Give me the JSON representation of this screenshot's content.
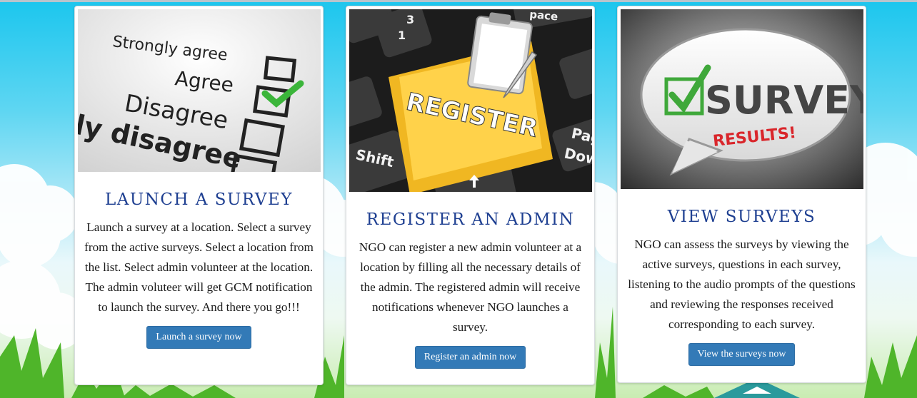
{
  "cards": [
    {
      "title": "LAUNCH A SURVEY",
      "description": "Launch a survey at a location. Select a survey from the active surveys. Select a location from the list. Select admin volunteer at the location. The admin voluteer will get GCM notification to launch the survey. And there you go!!!",
      "button": "Launch a survey now",
      "image": {
        "icon": "checklist-image",
        "lines": [
          "Strongly agree",
          "Agree",
          "Disagree",
          "ly disagree"
        ]
      }
    },
    {
      "title": "REGISTER AN ADMIN",
      "description": "NGO can register a new admin volunteer at a location by filling all the necessary details of the admin. The registered admin will receive notifications whenever NGO launches a survey.",
      "button": "Register an admin now",
      "image": {
        "icon": "keyboard-register-image",
        "key": "REGISTER",
        "shift": "Shift",
        "page": "Pag",
        "down": "Dow",
        "space": "pace",
        "key3": "3",
        "key1": "1"
      }
    },
    {
      "title": "VIEW SURVEYS",
      "description": "NGO can assess the surveys by viewing the active surveys, questions in each survey, listening to the audio prompts of the questions and reviewing the responses received corresponding to each survey.",
      "button": "View the surveys now",
      "image": {
        "icon": "survey-results-bubble-image",
        "word": "SURVEY",
        "sub": "RESULTS!"
      }
    }
  ],
  "colors": {
    "title": "#1e3f91",
    "button": "#337ab7",
    "sky": "#1cc6ee",
    "grass": "#4fb52a"
  }
}
